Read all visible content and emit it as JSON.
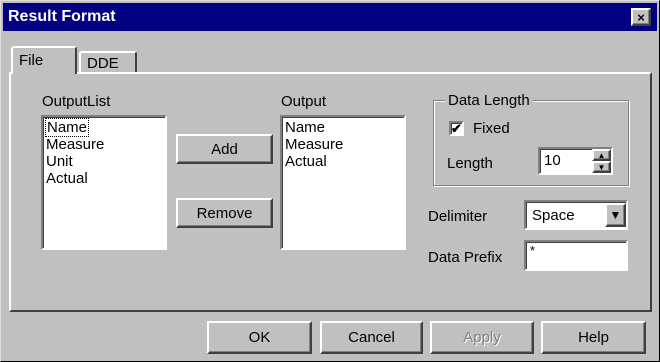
{
  "window": {
    "title": "Result Format",
    "close_glyph": "×"
  },
  "tabs": [
    {
      "label": "File",
      "active": true
    },
    {
      "label": "DDE",
      "active": false
    }
  ],
  "output_list": {
    "label": "OutputList",
    "items": [
      "Name",
      "Measure",
      "Unit",
      "Actual"
    ],
    "focused": "Name"
  },
  "buttons": {
    "add": "Add",
    "remove": "Remove"
  },
  "output": {
    "label": "Output",
    "items": [
      "Name",
      "Measure",
      "Actual"
    ]
  },
  "data_length": {
    "group_label": "Data Length",
    "fixed_label": "Fixed",
    "fixed_checked": true,
    "check_glyph": "✔",
    "length_label": "Length",
    "length_value": "10",
    "spin_up": "▲",
    "spin_down": "▼"
  },
  "delimiter": {
    "label": "Delimiter",
    "value": "Space",
    "arrow": "▼"
  },
  "data_prefix": {
    "label": "Data Prefix",
    "value": "*"
  },
  "footer": {
    "ok": "OK",
    "cancel": "Cancel",
    "apply": "Apply",
    "help": "Help",
    "apply_disabled": true
  }
}
